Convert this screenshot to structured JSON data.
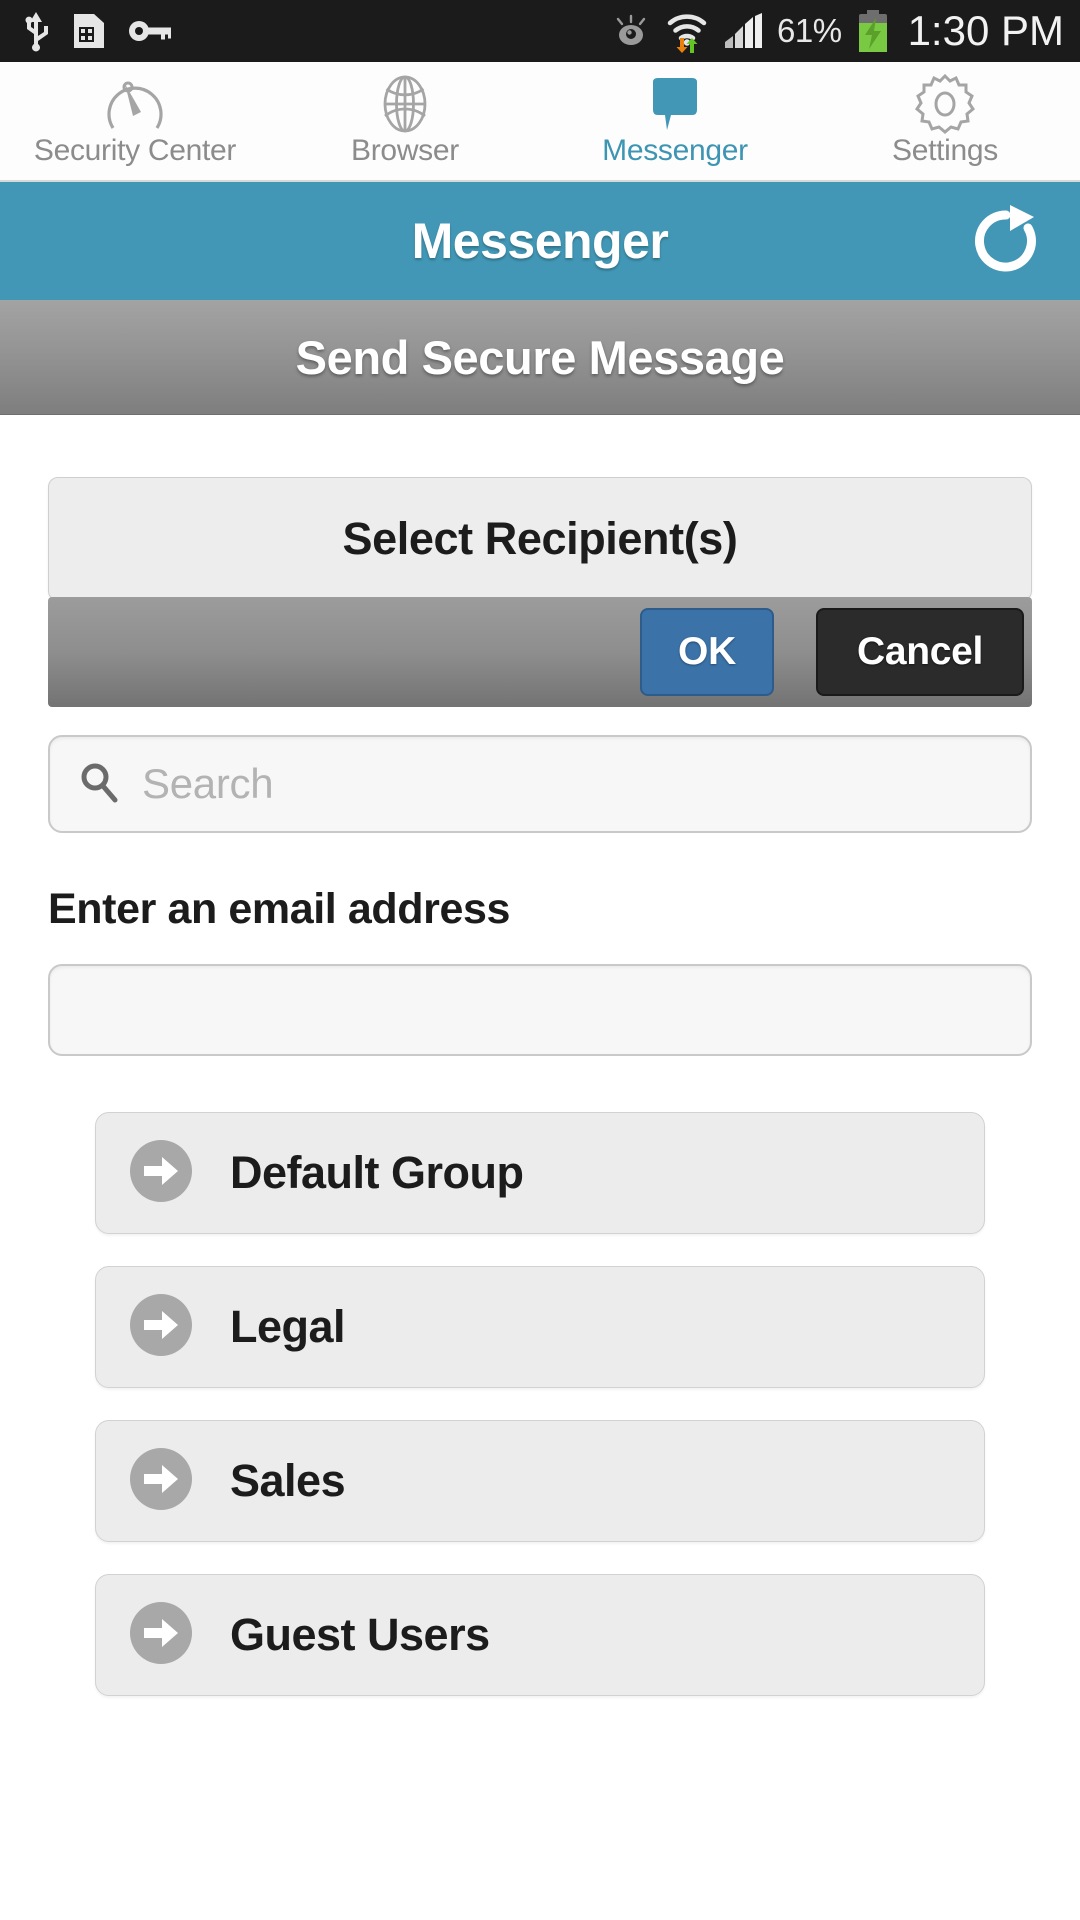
{
  "status_bar": {
    "left_icons": [
      "usb-icon",
      "sim-card-alert-icon",
      "vpn-key-icon"
    ],
    "right_icons": [
      "smart-stay-eye-icon",
      "wifi-transfer-icon",
      "cellular-signal-icon",
      "battery-charging-icon"
    ],
    "battery_percent": "61%",
    "time": "1:30 PM"
  },
  "tabs": [
    {
      "label": "Security Center",
      "icon": "gauge-icon",
      "active": false
    },
    {
      "label": "Browser",
      "icon": "globe-icon",
      "active": false
    },
    {
      "label": "Messenger",
      "icon": "speech-bubble-icon",
      "active": true
    },
    {
      "label": "Settings",
      "icon": "gear-icon",
      "active": false
    }
  ],
  "header": {
    "title": "Messenger",
    "refresh_icon": "refresh-icon",
    "accent_color": "#4197b5"
  },
  "subheader": {
    "title": "Send Secure Message"
  },
  "recipient_picker": {
    "title": "Select Recipient(s)",
    "ok_label": "OK",
    "cancel_label": "Cancel",
    "ok_color": "#3b72a8",
    "cancel_color": "#2b2b2b"
  },
  "search": {
    "placeholder": "Search",
    "value": "",
    "icon": "search-icon"
  },
  "email": {
    "label": "Enter an email address",
    "value": "",
    "placeholder": ""
  },
  "groups": [
    {
      "name": "Default Group",
      "icon": "arrow-right-circle-icon"
    },
    {
      "name": "Legal",
      "icon": "arrow-right-circle-icon"
    },
    {
      "name": "Sales",
      "icon": "arrow-right-circle-icon"
    },
    {
      "name": "Guest Users",
      "icon": "arrow-right-circle-icon"
    }
  ]
}
